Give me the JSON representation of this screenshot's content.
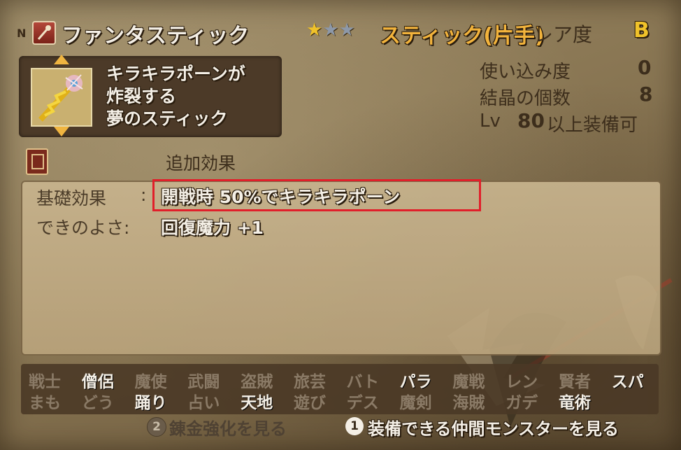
{
  "header": {
    "badge": "N",
    "item_name": "ファンタスティック",
    "stars_filled": 1,
    "stars_total": 3,
    "weapon_type": "スティック(片手)",
    "rarity_label": "レア度",
    "rarity_value": "B"
  },
  "description": {
    "lines": [
      "キラキラポーンが",
      "炸裂する",
      "夢のスティック"
    ]
  },
  "stats": {
    "usage_label": "使い込み度",
    "usage_value": "0",
    "crystal_label": "結晶の個数",
    "crystal_value": "8",
    "lv_label": "Lv",
    "lv_value": "80",
    "lv_suffix": "以上装備可"
  },
  "extra_effect_label": "追加効果",
  "effects": {
    "base_label": "基礎効果",
    "base_sep": ":",
    "base_value": "開戦時 50%でキラキラポーン",
    "quality_label": "できのよさ:",
    "quality_value": "回復魔力 +1"
  },
  "jobs": {
    "row1": [
      {
        "label": "戦士",
        "on": false
      },
      {
        "label": "僧侶",
        "on": true
      },
      {
        "label": "魔使",
        "on": false
      },
      {
        "label": "武闘",
        "on": false
      },
      {
        "label": "盗賊",
        "on": false
      },
      {
        "label": "旅芸",
        "on": false
      },
      {
        "label": "バト",
        "on": false
      },
      {
        "label": "パラ",
        "on": true
      },
      {
        "label": "魔戦",
        "on": false
      },
      {
        "label": "レン",
        "on": false
      },
      {
        "label": "賢者",
        "on": false
      },
      {
        "label": "スパ",
        "on": true
      }
    ],
    "row2": [
      {
        "label": "まも",
        "on": false
      },
      {
        "label": "どう",
        "on": false
      },
      {
        "label": "踊り",
        "on": true
      },
      {
        "label": "占い",
        "on": false
      },
      {
        "label": "天地",
        "on": true
      },
      {
        "label": "遊び",
        "on": false
      },
      {
        "label": "デス",
        "on": false
      },
      {
        "label": "魔剣",
        "on": false
      },
      {
        "label": "海賊",
        "on": false
      },
      {
        "label": "ガデ",
        "on": false
      },
      {
        "label": "竜術",
        "on": true
      }
    ]
  },
  "footer": {
    "btn2_num": "2",
    "btn2_label": "錬金強化を見る",
    "btn1_num": "1",
    "btn1_label": "装備できる仲間モンスターを見る"
  },
  "colors": {
    "accent_gold": "#f0c22a",
    "weapon_type": "#f2b33c",
    "highlight": "#e11f2a"
  }
}
